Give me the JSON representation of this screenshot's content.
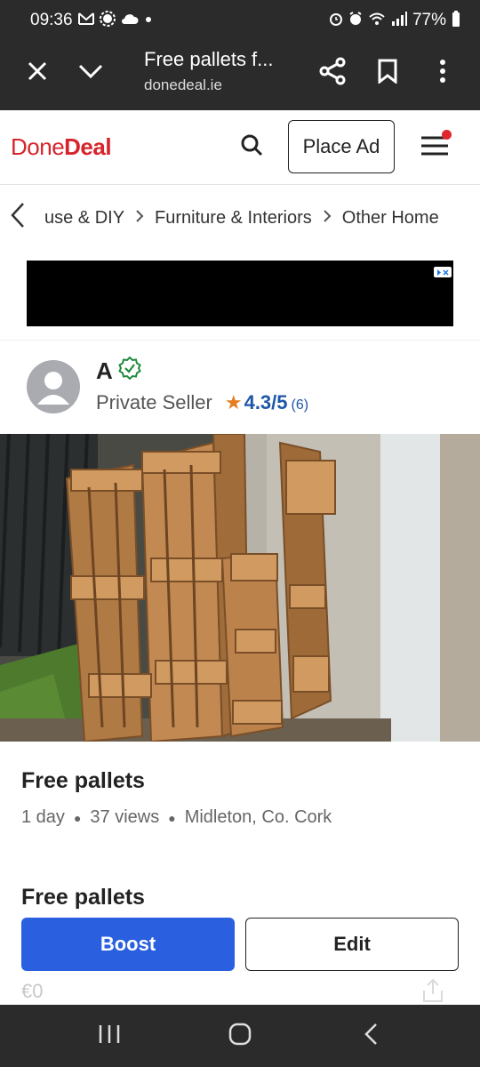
{
  "status_bar": {
    "time": "09:36",
    "battery": "77%",
    "left_icons": [
      "gmail-icon",
      "settings-icon",
      "cloud-icon",
      "dot-icon"
    ],
    "right_icons": [
      "alarm-clock-icon",
      "wifi-icon",
      "signal-icon",
      "battery-icon"
    ]
  },
  "browser": {
    "page_title": "Free pallets f...",
    "domain": "donedeal.ie",
    "close_icon": "close-icon",
    "collapse_icon": "chevron-down-icon",
    "share_icon": "share-icon",
    "bookmark_icon": "bookmark-icon",
    "more_icon": "more-vertical-icon"
  },
  "header": {
    "logo_done": "Done",
    "logo_deal": "Deal",
    "place_ad_label": "Place Ad",
    "colors": {
      "brand_red": "#d6242c",
      "notification_dot": "#e0262f"
    }
  },
  "breadcrumb": {
    "items": [
      "use & DIY",
      "Furniture & Interiors",
      "Other Home"
    ]
  },
  "seller": {
    "name": "A",
    "type": "Private Seller",
    "rating": "4.3/5",
    "rating_count": "(6)",
    "verified": true,
    "colors": {
      "rating": "#1e56a8",
      "star": "#e47d1f",
      "verified": "#1f8a3c"
    }
  },
  "listing": {
    "title": "Free pallets",
    "age": "1 day",
    "views": "37 views",
    "location": "Midleton, Co. Cork",
    "section_title": "Free pallets",
    "price": "€0"
  },
  "actions": {
    "boost_label": "Boost",
    "edit_label": "Edit",
    "colors": {
      "boost_bg": "#2a5fe0"
    }
  },
  "nav_bar": {
    "recent_apps_icon": "recent-apps-icon",
    "home_icon": "home-icon",
    "back_icon": "back-icon"
  }
}
